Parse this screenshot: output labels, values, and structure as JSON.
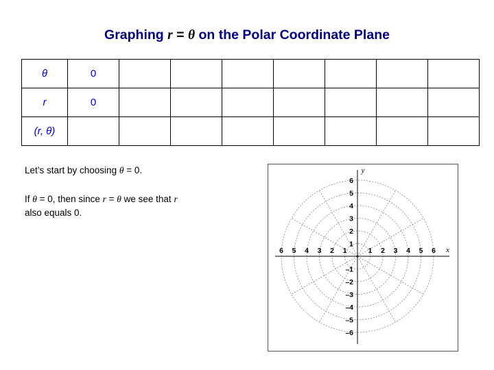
{
  "title": {
    "prefix": "Graphing ",
    "equation_r": "r",
    "equation_eq": " = ",
    "equation_theta": "θ",
    "suffix": " on the Polar Coordinate Plane"
  },
  "table": {
    "rows": [
      {
        "header": "θ",
        "cells": [
          "0",
          "",
          "",
          "",
          "",
          "",
          "",
          ""
        ]
      },
      {
        "header": "r",
        "cells": [
          "0",
          "",
          "",
          "",
          "",
          "",
          "",
          ""
        ]
      },
      {
        "header": "(r, θ)",
        "cells": [
          "",
          "",
          "",
          "",
          "",
          "",
          "",
          ""
        ]
      }
    ]
  },
  "body": {
    "para1_a": "Let’s start by choosing ",
    "para1_theta": "θ",
    "para1_b": " = 0.",
    "para2_a": "If ",
    "para2_theta1": "θ",
    "para2_b": " = 0, then since ",
    "para2_r1": "r",
    "para2_c": " = ",
    "para2_theta2": "θ",
    "para2_d": " we see that ",
    "para2_r2": "r",
    "para2_e": "also equals 0."
  },
  "graph": {
    "axis_label_x": "x",
    "axis_label_y": "y",
    "x_ticks_left": [
      "6",
      "5",
      "4",
      "3",
      "2",
      "1"
    ],
    "x_ticks_right": [
      "1",
      "2",
      "3",
      "4",
      "5",
      "6"
    ],
    "y_ticks_up": [
      "1",
      "2",
      "3",
      "4",
      "5",
      "6"
    ],
    "y_ticks_down": [
      "–1",
      "–2",
      "–3",
      "–4",
      "–5",
      "–6"
    ],
    "radial_circles": [
      1,
      2,
      3,
      4,
      5,
      6
    ],
    "ray_count": 12,
    "grid_color": "#888888",
    "axis_color": "#000000"
  },
  "colors": {
    "title": "#000080",
    "table_value": "#0000cc",
    "text": "#000000"
  }
}
